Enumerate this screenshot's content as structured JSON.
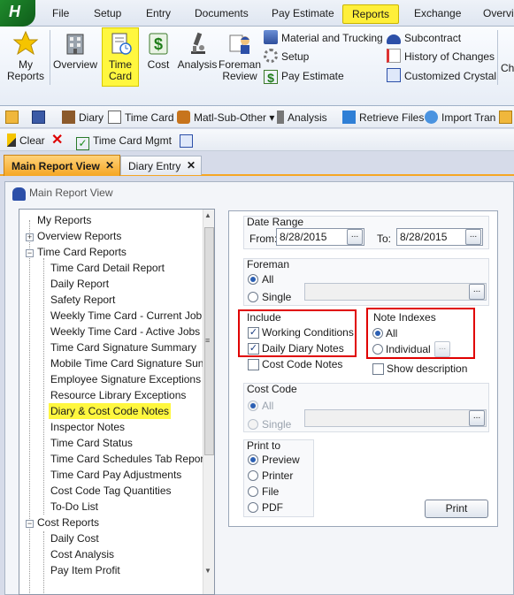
{
  "menu": {
    "items": [
      "File",
      "Setup",
      "Entry",
      "Documents",
      "Pay Estimate",
      "Reports",
      "Exchange",
      "Overvie"
    ]
  },
  "ribbon": {
    "buttons": [
      "My Reports",
      "Overview",
      "Time Card",
      "Cost",
      "Analysis",
      "Foreman Review"
    ],
    "my_reports_l1": "My",
    "my_reports_l2": "Reports",
    "time_l1": "Time",
    "time_l2": "Card",
    "foreman_l1": "Foreman",
    "foreman_l2": "Review",
    "small_col1": [
      "Material and Trucking",
      "Setup",
      "Pay Estimate"
    ],
    "small_col2": [
      "Subcontract",
      "History of Changes",
      "Customized Crystal"
    ],
    "cut_label": "Ch"
  },
  "toolbar1": {
    "diary": "Diary",
    "time_card": "Time Card",
    "matl": "Matl-Sub-Other",
    "analysis": "Analysis",
    "retrieve": "Retrieve Files",
    "import": "Import Tran"
  },
  "toolbar2": {
    "clear": "Clear",
    "time_card_mgmt": "Time Card Mgmt"
  },
  "tabs": {
    "main": "Main Report View",
    "diary": "Diary Entry"
  },
  "panel": {
    "title": "Main Report View"
  },
  "tree": {
    "items": [
      "My Reports",
      "Overview Reports",
      "Time Card Reports",
      "Time Card Detail Report",
      "Daily Report",
      "Safety Report",
      "Weekly Time Card - Current Job",
      "Weekly Time Card - Active Jobs",
      "Time Card Signature Summary",
      "Mobile Time Card Signature Sun",
      "Employee Signature Exceptions",
      "Resource Library Exceptions",
      "Diary & Cost Code Notes",
      "Inspector Notes",
      "Time Card Status",
      "Time Card Schedules Tab Report",
      "Time Card Pay Adjustments",
      "Cost Code Tag Quantities",
      "To-Do List",
      "Cost Reports",
      "Daily Cost",
      "Cost Analysis",
      "Pay Item Profit"
    ]
  },
  "form": {
    "date_range": "Date Range",
    "from_label": "From:",
    "from_value": "8/28/2015",
    "to_label": "To:",
    "to_value": "8/28/2015",
    "foreman": "Foreman",
    "all": "All",
    "single": "Single",
    "include": "Include",
    "working_conditions": "Working Conditions",
    "daily_diary_notes": "Daily Diary Notes",
    "cost_code_notes": "Cost Code Notes",
    "note_indexes": "Note Indexes",
    "individual": "Individual",
    "show_description": "Show description",
    "cost_code": "Cost Code",
    "print_to": "Print to",
    "preview": "Preview",
    "printer": "Printer",
    "file": "File",
    "pdf": "PDF",
    "print_button": "Print",
    "dots": "..."
  },
  "colors": {
    "highlight": "#fff73f",
    "active_tab": "#f5a623",
    "red_box": "#e00000"
  }
}
